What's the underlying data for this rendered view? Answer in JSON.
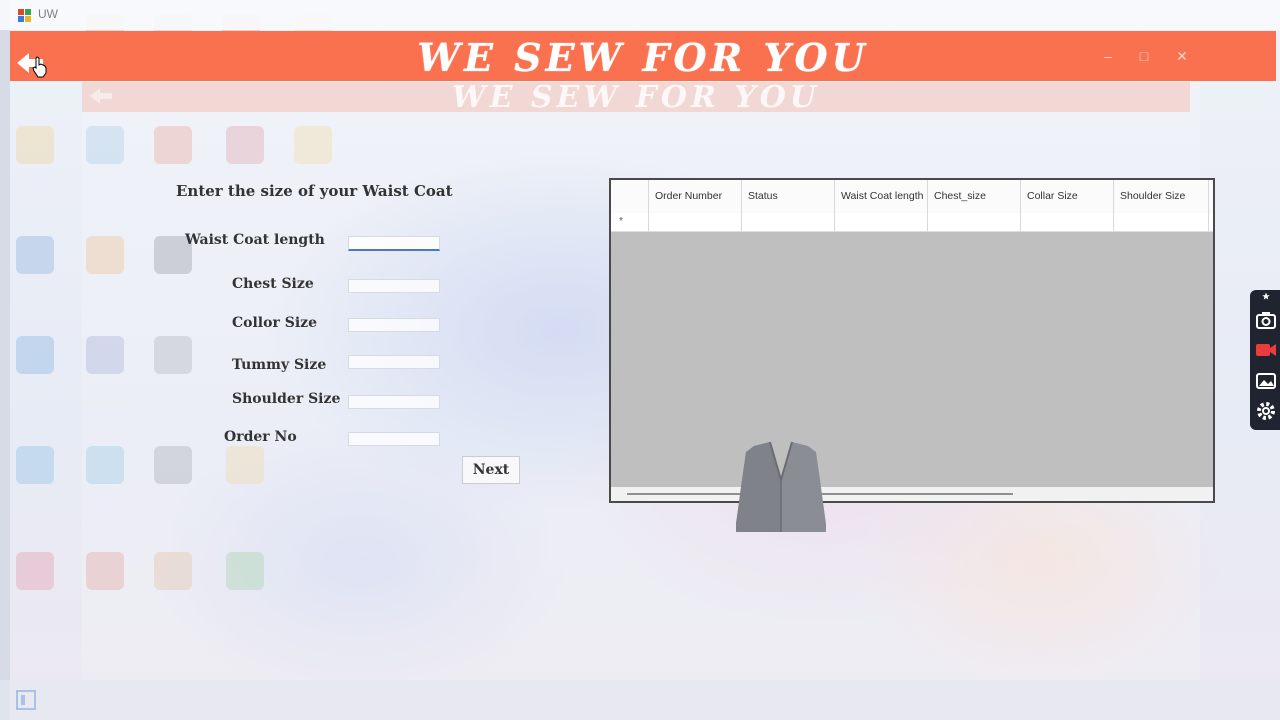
{
  "window": {
    "title": "UW",
    "controls": [
      "minimize",
      "maximize",
      "close"
    ]
  },
  "banner": {
    "title": "WE SEW FOR YOU",
    "back_icon": "back-arrow-icon",
    "color": "#fa7150"
  },
  "form": {
    "heading": "Enter the size of your Waist Coat",
    "fields": [
      {
        "label": "Waist Coat length",
        "value": ""
      },
      {
        "label": "Chest Size",
        "value": ""
      },
      {
        "label": "Collor Size",
        "value": ""
      },
      {
        "label": "Tummy Size",
        "value": ""
      },
      {
        "label": "Shoulder Size",
        "value": ""
      },
      {
        "label": "Order No",
        "value": ""
      }
    ],
    "next_label": "Next"
  },
  "grid": {
    "columns": [
      "Order Number",
      "Status",
      "Waist Coat length",
      "Chest_size",
      "Collar Size",
      "Shoulder Size"
    ],
    "new_row_marker": "*"
  },
  "side_tools": [
    "pin-icon",
    "camera-icon",
    "video-icon",
    "gallery-icon",
    "settings-icon"
  ],
  "colors": {
    "accent": "#fa7150",
    "grid_bg": "#bfbfbf",
    "active_field": "#4a78c2"
  }
}
